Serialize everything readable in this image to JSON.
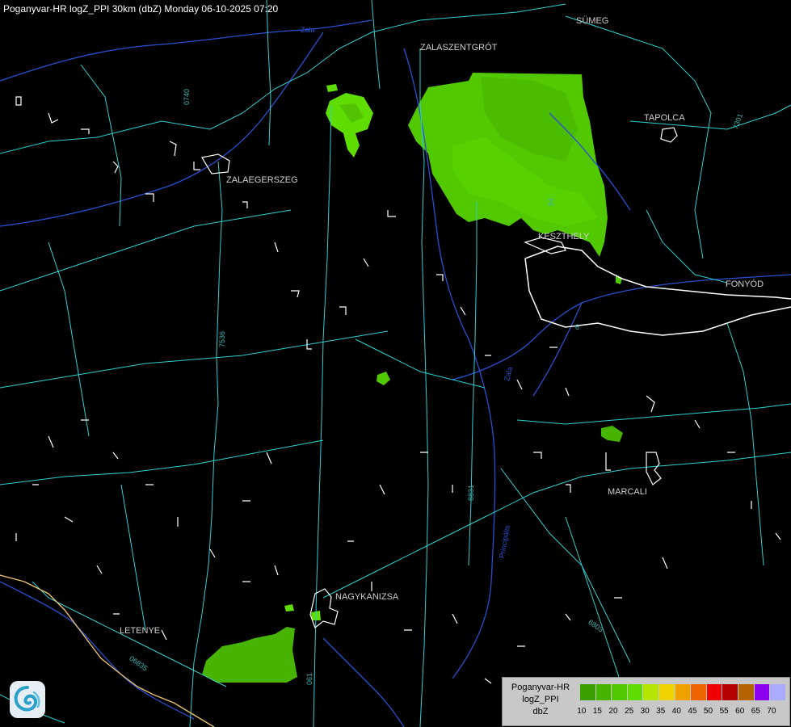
{
  "title": "Poganyvar-HR logZ_PPI 30km (dbZ) Monday 06-10-2025 07:20",
  "towns": [
    {
      "key": "sumeg",
      "label": "SÜMEG"
    },
    {
      "key": "zalaszentgrot",
      "label": "ZALASZENTGRÓT"
    },
    {
      "key": "tapolca",
      "label": "TAPOLCA"
    },
    {
      "key": "zalaegerszeg",
      "label": "ZALAEGERSZEG"
    },
    {
      "key": "keszthely",
      "label": "KESZTHELY"
    },
    {
      "key": "fonyod",
      "label": "FONYÓD"
    },
    {
      "key": "marcali",
      "label": "MARCALI"
    },
    {
      "key": "nagykanizsa",
      "label": "NAGYKANIZSA"
    },
    {
      "key": "letenye",
      "label": "LETENYE"
    }
  ],
  "roads": [
    "0740",
    "7301",
    "84",
    "7536",
    "8831",
    "6803",
    "06835",
    "061",
    "6"
  ],
  "rivers": [
    "Zala",
    "Zala",
    "Principális"
  ],
  "legend": {
    "line1": "Poganyvar-HR",
    "line2": "logZ_PPI",
    "line3": "dbZ",
    "colors": [
      "#3aa000",
      "#46b400",
      "#52c800",
      "#5fdc00",
      "#b4e600",
      "#f0d200",
      "#f0a000",
      "#f06400",
      "#f00000",
      "#b40000",
      "#b46400",
      "#8c00f0",
      "#aaaaff"
    ],
    "ticks": [
      "10",
      "15",
      "20",
      "25",
      "30",
      "35",
      "40",
      "45",
      "50",
      "55",
      "60",
      "65",
      "70"
    ]
  },
  "echoes": [
    {
      "key": "echo-north-east",
      "dbz": "20-25",
      "color": "#52c800"
    },
    {
      "key": "echo-north-small",
      "dbz": "20-25",
      "color": "#5fdc00"
    },
    {
      "key": "echo-south-west",
      "dbz": "15",
      "color": "#46b400"
    }
  ]
}
